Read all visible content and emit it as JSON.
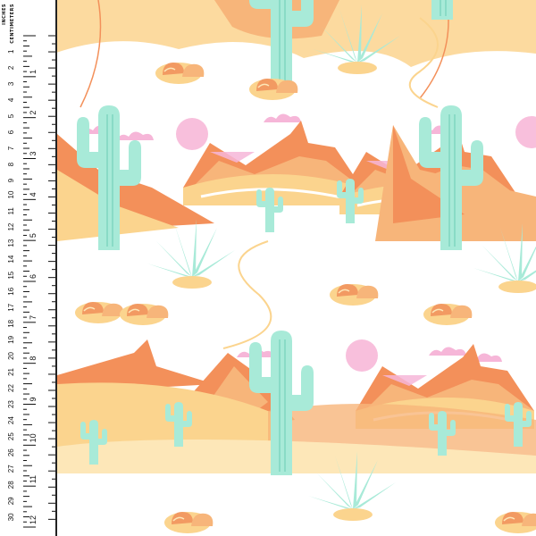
{
  "ruler": {
    "inches_label": "INCHES",
    "centimeters_label": "CENTIMETERS",
    "inch_marks": [
      "1",
      "2",
      "3",
      "4",
      "5",
      "6",
      "7",
      "8",
      "9",
      "10",
      "11",
      "12"
    ],
    "cm_marks": [
      "1",
      "2",
      "3",
      "4",
      "5",
      "6",
      "7",
      "8",
      "9",
      "10",
      "11",
      "12",
      "13",
      "14",
      "15",
      "16",
      "17",
      "18",
      "19",
      "20",
      "21",
      "22",
      "23",
      "24",
      "25",
      "26",
      "27",
      "28",
      "29",
      "30"
    ]
  },
  "palette": {
    "background": "#ffffff",
    "cactus": "#a8ead8",
    "cactus_shade": "#7fd6bf",
    "mesa_orange": "#f3905a",
    "mesa_peach": "#f7b57a",
    "sand": "#fbd48e",
    "sand_light": "#fde7b8",
    "cloud_pink": "#f6b6d8",
    "sun_pink": "#f8bfdc",
    "rock": "#f29a62"
  },
  "icons": {
    "cactus": "saguaro-cactus",
    "agave": "agave-plant",
    "sun": "sun",
    "cloud": "cloud",
    "mesa": "mesa-mountain",
    "rock": "desert-rock"
  }
}
